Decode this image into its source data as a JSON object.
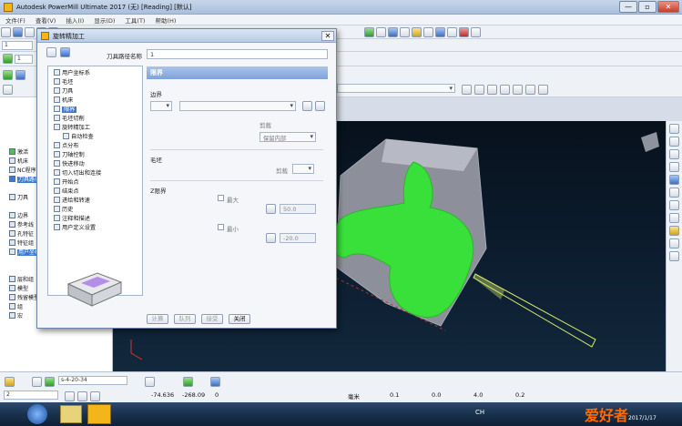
{
  "window": {
    "title": "Autodesk PowerMill Ultimate 2017  (无)  [Reading]  [默认]",
    "min_label": "—",
    "max_label": "▫",
    "close_label": "✕"
  },
  "menu": [
    "文件(F)",
    "查看(V)",
    "插入(I)",
    "显示(D)",
    "工具(T)",
    "帮助(H)"
  ],
  "toolbar": {
    "row2_value": "1",
    "row3_value": "1"
  },
  "tree": {
    "items": [
      "激活",
      "机床",
      "NC程序",
      "刀具路径",
      "刀具",
      "边界",
      "参考线",
      "孔特征",
      "特征组",
      "用户坐标",
      "层和组",
      "模型",
      "残留模型",
      "组",
      "宏"
    ]
  },
  "dialog": {
    "title": "旋转精加工",
    "path_name_label": "刀具路径名称",
    "path_name_value": "1",
    "tree": [
      {
        "label": "用户坐标系",
        "indent": 0
      },
      {
        "label": "毛坯",
        "indent": 0
      },
      {
        "label": "刀具",
        "indent": 0
      },
      {
        "label": "机床",
        "indent": 0
      },
      {
        "label": "限界",
        "indent": 0,
        "selected": true
      },
      {
        "label": "毛坯切削",
        "indent": 0
      },
      {
        "label": "旋转精加工",
        "indent": 0
      },
      {
        "label": "自动检查",
        "indent": 1
      },
      {
        "label": "点分布",
        "indent": 0
      },
      {
        "label": "刀轴控制",
        "indent": 0
      },
      {
        "label": "快进移动",
        "indent": 0
      },
      {
        "label": "切入切出和连接",
        "indent": 0
      },
      {
        "label": "开始点",
        "indent": 0
      },
      {
        "label": "结束点",
        "indent": 0
      },
      {
        "label": "进给和转速",
        "indent": 0
      },
      {
        "label": "历史",
        "indent": 0
      },
      {
        "label": "注释和描述",
        "indent": 0
      },
      {
        "label": "用户定义设置",
        "indent": 0
      }
    ],
    "section_title": "限界",
    "boundary_label": "边界",
    "clip_label": "剪裁",
    "clip_value": "保留内部",
    "stock_label": "毛坯",
    "stock_clip_label": "剪裁",
    "z_limit_label": "Z限界",
    "max_label": "最大",
    "max_value": "50.0",
    "min_label": "最小",
    "min_value": "-20.0",
    "buttons": [
      "计算",
      "队列",
      "接受",
      "关闭"
    ]
  },
  "status": {
    "tool_value": "s-4-20-34",
    "layer_value": "2",
    "x": "-74.636",
    "y": "-268.09",
    "z": "0",
    "unit": "毫米",
    "tol1": "0.1",
    "tol2": "0.0",
    "tol3": "4.0",
    "tol4": "0.2"
  },
  "taskbar": {
    "ime": "CH",
    "date": "2017/1/17",
    "watermark": "爱好者"
  },
  "colors": {
    "viewport_bg": "#0a1a2a",
    "model_green": "#39e03a",
    "selection": "#3a7ad1"
  }
}
